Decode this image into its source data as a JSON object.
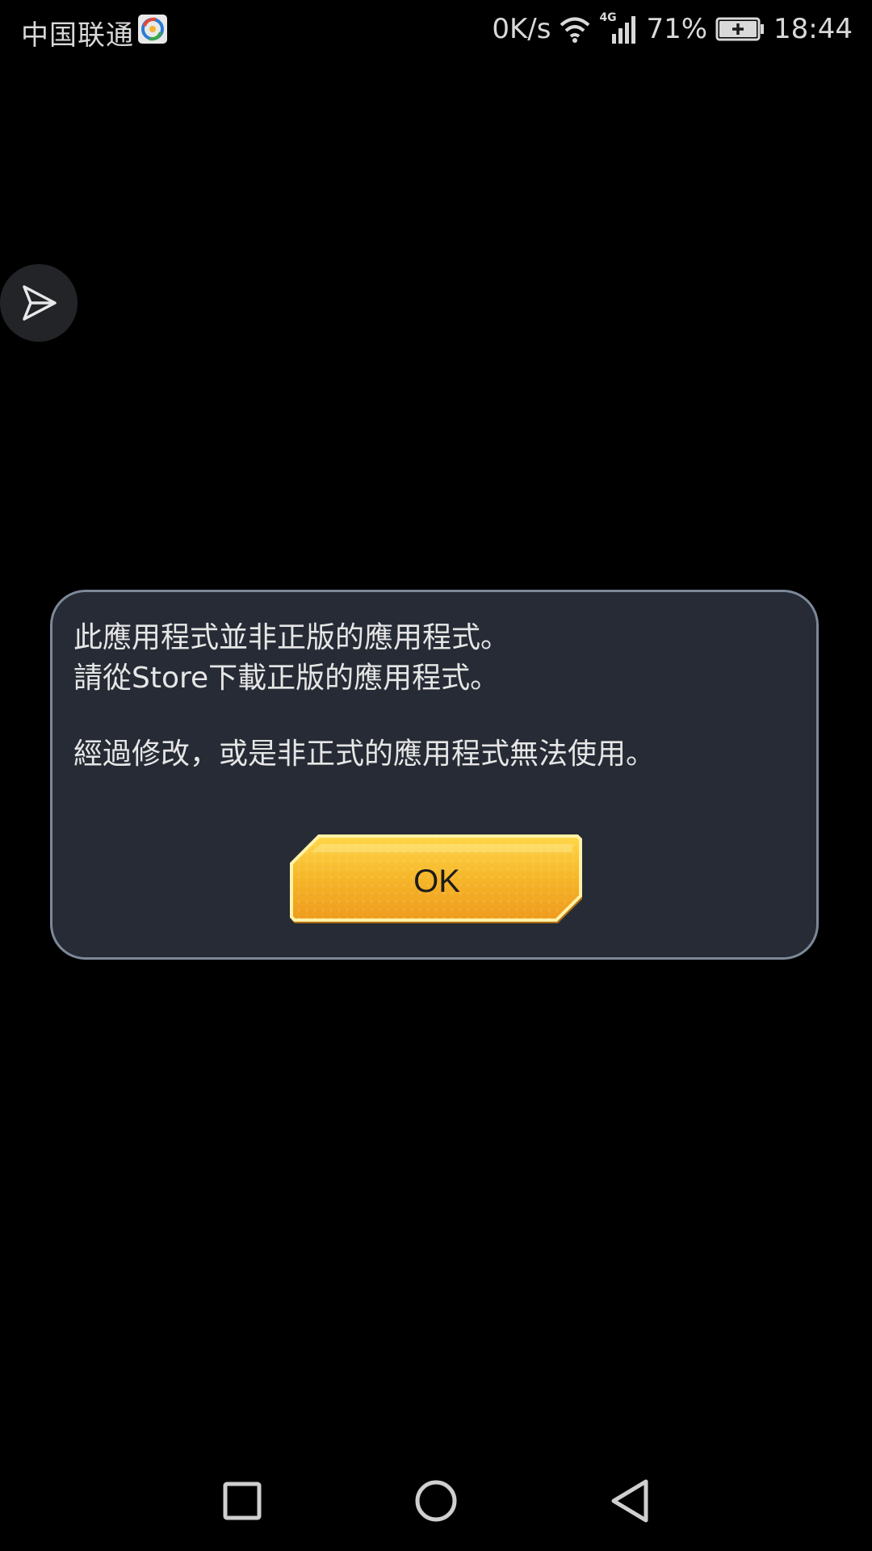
{
  "status_bar": {
    "carrier": "中国联通",
    "net_speed": "0K/s",
    "network_type": "4G",
    "battery_percent": "71%",
    "time": "18:44",
    "icons": [
      "carrier-app-icon",
      "wifi-icon",
      "signal-icon",
      "battery-icon"
    ]
  },
  "floating_button": {
    "icon": "send-arrow-icon"
  },
  "dialog": {
    "line1": "此應用程式並非正版的應用程式。",
    "line2": "請從Store下載正版的應用程式。",
    "line3": "經過修改，或是非正式的應用程式無法使用。",
    "ok_label": "OK",
    "colors": {
      "background": "#262b35",
      "border": "#7d8899",
      "button": "#f3b320"
    }
  },
  "nav_bar": {
    "icons": [
      "recents-square-icon",
      "home-circle-icon",
      "back-triangle-icon"
    ]
  }
}
